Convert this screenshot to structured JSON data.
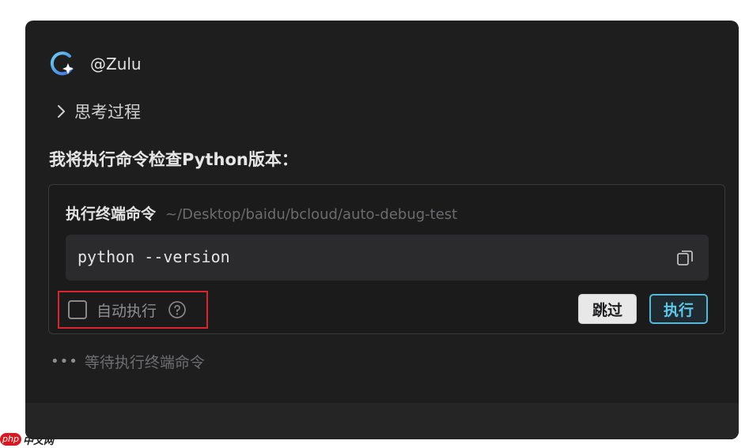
{
  "agent": {
    "name": "@Zulu",
    "logo_icon": "zulu-logo-icon"
  },
  "thinking": {
    "label": "思考过程",
    "icon": "chevron-right-icon"
  },
  "message": {
    "text": "我将执行命令检查Python版本："
  },
  "command_card": {
    "title": "执行终端命令",
    "path": "~/Desktop/baidu/bcloud/auto-debug-test",
    "code": "python --version",
    "copy_icon": "copy-icon",
    "auto_execute": {
      "label": "自动执行",
      "checked": false,
      "help_icon": "help-circle-icon"
    },
    "skip_label": "跳过",
    "run_label": "执行"
  },
  "status": {
    "dots": "•••",
    "text": "等待执行终端命令"
  },
  "watermark": {
    "badge": "php",
    "text": "中文网"
  },
  "colors": {
    "panel_bg": "#1e1e1f",
    "accent": "#56b8d9",
    "highlight_border": "#d9262e"
  }
}
